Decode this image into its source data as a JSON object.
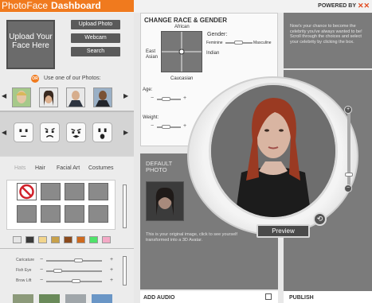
{
  "header": {
    "brand_light": "PhotoFace",
    "brand_bold": "Dashboard",
    "powered_by": "POWERED BY"
  },
  "upload": {
    "box_label": "Upload Your Face Here",
    "buttons": [
      "Upload Photo",
      "Webcam",
      "Search"
    ],
    "or_badge": "OR",
    "use_photos_text": "Use one of our Photos:"
  },
  "tools": {
    "tabs": [
      "Hats",
      "Hair",
      "Facial Art",
      "Costumes"
    ],
    "swatch_colors": [
      "#e6e6e6",
      "#3a3a3a",
      "#f2d58c",
      "#c8a14a",
      "#8b4a1c",
      "#cf6a1e",
      "#4fe36a",
      "#f4a9c6"
    ],
    "sliders": [
      {
        "label": "Caricature",
        "value": 0.6
      },
      {
        "label": "Fish Eye",
        "value": 0.15
      },
      {
        "label": "Brow Lift",
        "value": 0.55
      }
    ]
  },
  "race": {
    "title": "CHANGE RACE & GENDER",
    "top": "African",
    "left": "East Asian",
    "right": "Indian",
    "bottom": "Caucasian",
    "gender_label": "Gender:",
    "female": "Feminine",
    "male": "Masculine",
    "age_label": "Age:",
    "weight_label": "Weight:"
  },
  "info": {
    "text": "Now's your chance to become the celebrity you've always wanted to be! Scroll through the choices and select your celebrity by clicking the box."
  },
  "default_photo": {
    "title": "DEFAULT PHOTO",
    "text": "This is your original image, click to see yourself transformed into a 3D Avatar."
  },
  "viewer": {
    "preview_label": "Preview"
  },
  "bottom": {
    "add_audio": "ADD AUDIO",
    "publish": "PUBLISH"
  },
  "colors": {
    "accent": "#f07a1e",
    "panel_dark": "#7b7b7b"
  }
}
